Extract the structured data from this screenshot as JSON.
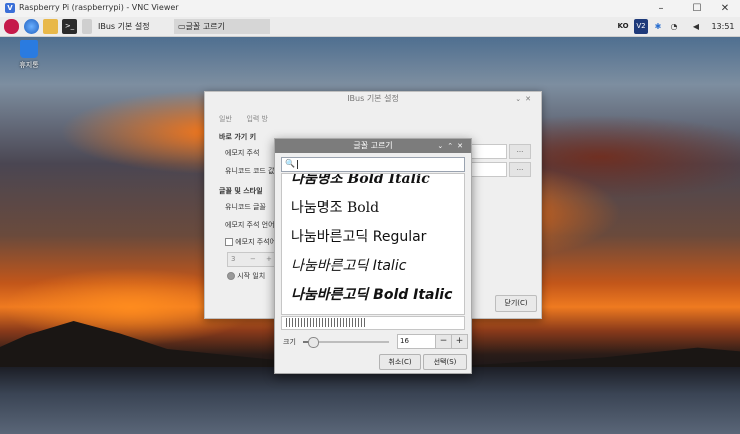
{
  "vnc": {
    "title": "Raspberry Pi (raspberrypi) - VNC Viewer",
    "minimize": "–",
    "maximize": "☐",
    "close": "✕"
  },
  "taskbar": {
    "ibus_settings": "IBus 기본 설정",
    "font_chooser": "글꼴 고르기",
    "lang": "KO",
    "vnc_badge": "V2",
    "clock": "13:51"
  },
  "desktop": {
    "trash_label": "휴지통"
  },
  "ibus_window": {
    "title": "IBus 기본 설정",
    "tabs": [
      "일반",
      "입력 방"
    ],
    "shortcuts_heading": "바로 가기 키",
    "emoji_annotation": "에모지 주석",
    "unicode_code": "유니코드 코드 값",
    "font_style_heading": "글꼴 및 스타일",
    "unicode_font": "유니코드 글꼴",
    "emoji_annot_lang": "에모지 주석 언어",
    "emoji_annot_check": "에모지 주석어",
    "spin_value": "3",
    "spin_minus": "−",
    "spin_plus": "+",
    "radio_label": "시작 일치",
    "dots": "...",
    "close_button": "닫기(C)"
  },
  "font_chooser": {
    "title": "글꼴 고르기",
    "search_icon": "🔍",
    "fonts": [
      "나눔명조 Bold Italic",
      "나눔명조 Bold",
      "나눔바른고딕 Regular",
      "나눔바른고딕 Italic",
      "나눔바른고딕 Bold Italic"
    ],
    "size_label": "크기",
    "size_value": "16",
    "size_slider_fraction": 0.1,
    "minus": "−",
    "plus": "+",
    "cancel": "취소(C)",
    "select": "선택(S)"
  }
}
